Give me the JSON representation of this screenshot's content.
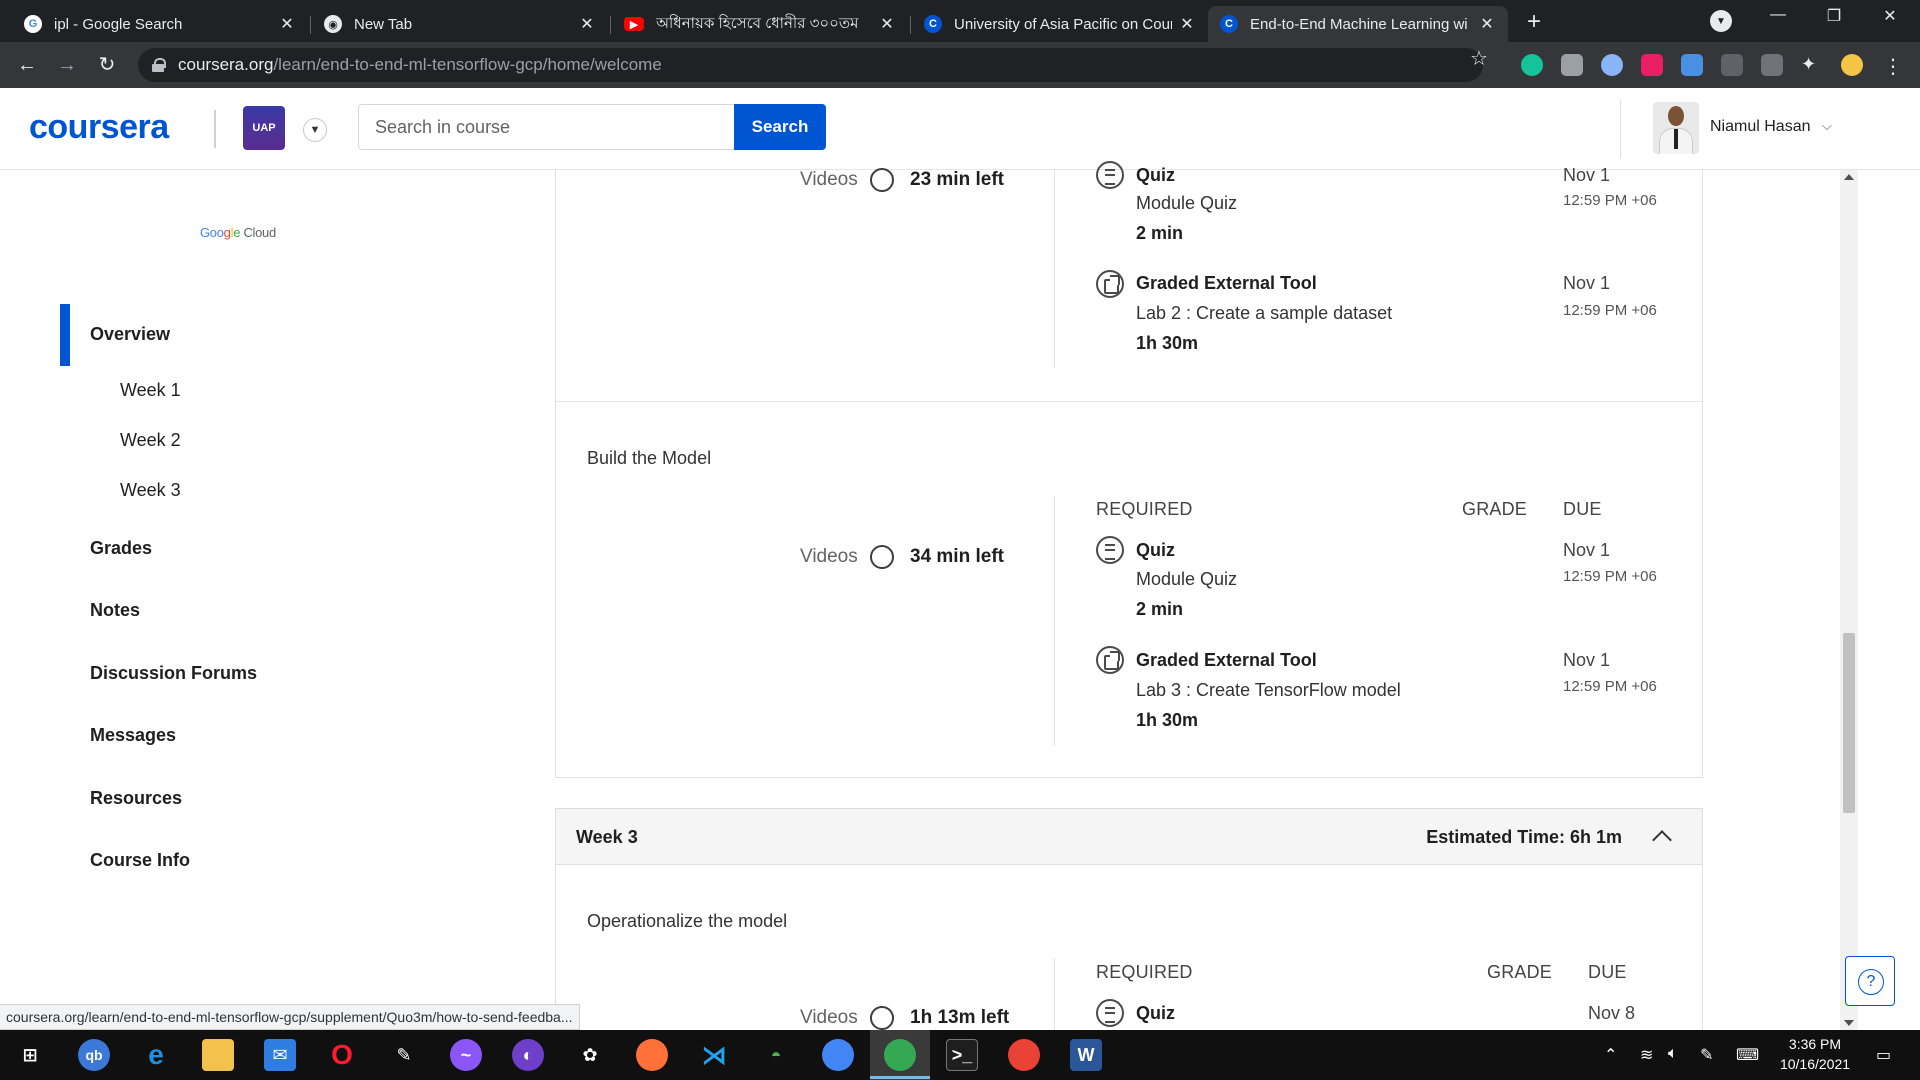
{
  "browser": {
    "tabs": [
      {
        "title": "ipl - Google Search",
        "icon": "google-icon"
      },
      {
        "title": "New Tab",
        "icon": "chrome-icon"
      },
      {
        "title": "অধিনায়ক হিসেবে ধোনীর ৩০০তম",
        "icon": "youtube-icon"
      },
      {
        "title": "University of Asia Pacific on Cour",
        "icon": "coursera-icon"
      },
      {
        "title": "End-to-End Machine Learning wi",
        "icon": "coursera-icon"
      }
    ],
    "url_host": "coursera.org",
    "url_path": "/learn/end-to-end-ml-tensorflow-gcp/home/welcome",
    "status_url": "coursera.org/learn/end-to-end-ml-tensorflow-gcp/supplement/Quo3m/how-to-send-feedba..."
  },
  "header": {
    "logo": "coursera",
    "search_placeholder": "Search in course",
    "search_button": "Search",
    "user_name": "Niamul Hasan"
  },
  "sidebar": {
    "partner": {
      "g1": "Goo",
      "g2": "g",
      "g3": "l",
      "g4": "e",
      "cloud": " Cloud"
    },
    "items": [
      {
        "label": "Overview",
        "active": true
      },
      {
        "label": "Week 1"
      },
      {
        "label": "Week 2"
      },
      {
        "label": "Week 3"
      },
      {
        "label": "Grades"
      },
      {
        "label": "Notes"
      },
      {
        "label": "Discussion Forums"
      },
      {
        "label": "Messages"
      },
      {
        "label": "Resources"
      },
      {
        "label": "Course Info"
      }
    ]
  },
  "main": {
    "section1": {
      "videos_label": "Videos",
      "videos_left": "23 min left",
      "items": [
        {
          "type": "Quiz",
          "name": "Module Quiz",
          "duration": "2 min",
          "due_date": "Nov 1",
          "due_time": "12:59 PM +06"
        },
        {
          "type": "Graded External Tool",
          "name": "Lab 2 : Create a sample dataset",
          "duration": "1h 30m",
          "due_date": "Nov 1",
          "due_time": "12:59 PM +06"
        }
      ]
    },
    "section2": {
      "title": "Build the Model",
      "videos_label": "Videos",
      "videos_left": "34 min left",
      "col_required": "REQUIRED",
      "col_grade": "GRADE",
      "col_due": "DUE",
      "items": [
        {
          "type": "Quiz",
          "name": "Module Quiz",
          "duration": "2 min",
          "due_date": "Nov 1",
          "due_time": "12:59 PM +06"
        },
        {
          "type": "Graded External Tool",
          "name": "Lab 3 : Create TensorFlow model",
          "duration": "1h 30m",
          "due_date": "Nov 1",
          "due_time": "12:59 PM +06"
        }
      ]
    },
    "week3": {
      "title": "Week 3",
      "estimated": "Estimated Time: 6h 1m",
      "lesson_title": "Operationalize the model",
      "videos_label": "Videos",
      "videos_left": "1h 13m left",
      "col_required": "REQUIRED",
      "col_grade": "GRADE",
      "col_due": "DUE",
      "items": [
        {
          "type": "Quiz",
          "due_date": "Nov 8"
        }
      ]
    }
  },
  "taskbar": {
    "time": "3:36 PM",
    "date": "10/16/2021"
  }
}
